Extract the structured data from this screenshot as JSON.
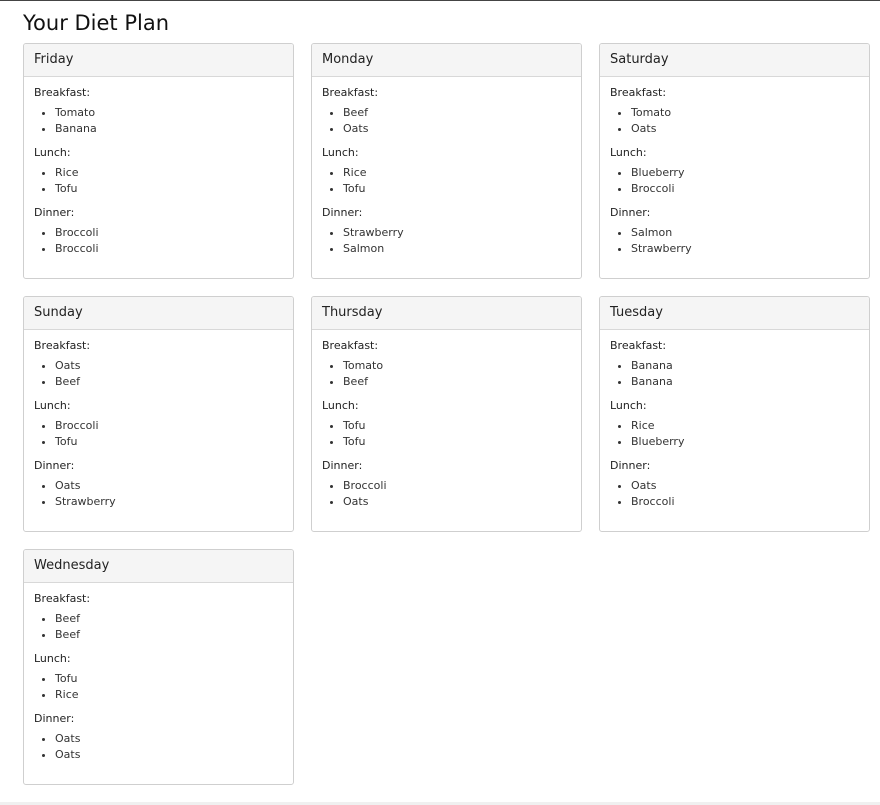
{
  "page": {
    "title": "Your Diet Plan"
  },
  "meal_labels": {
    "breakfast": "Breakfast:",
    "lunch": "Lunch:",
    "dinner": "Dinner:"
  },
  "days": [
    {
      "name": "Friday",
      "breakfast": [
        "Tomato",
        "Banana"
      ],
      "lunch": [
        "Rice",
        "Tofu"
      ],
      "dinner": [
        "Broccoli",
        "Broccoli"
      ]
    },
    {
      "name": "Monday",
      "breakfast": [
        "Beef",
        "Oats"
      ],
      "lunch": [
        "Rice",
        "Tofu"
      ],
      "dinner": [
        "Strawberry",
        "Salmon"
      ]
    },
    {
      "name": "Saturday",
      "breakfast": [
        "Tomato",
        "Oats"
      ],
      "lunch": [
        "Blueberry",
        "Broccoli"
      ],
      "dinner": [
        "Salmon",
        "Strawberry"
      ]
    },
    {
      "name": "Sunday",
      "breakfast": [
        "Oats",
        "Beef"
      ],
      "lunch": [
        "Broccoli",
        "Tofu"
      ],
      "dinner": [
        "Oats",
        "Strawberry"
      ]
    },
    {
      "name": "Thursday",
      "breakfast": [
        "Tomato",
        "Beef"
      ],
      "lunch": [
        "Tofu",
        "Tofu"
      ],
      "dinner": [
        "Broccoli",
        "Oats"
      ]
    },
    {
      "name": "Tuesday",
      "breakfast": [
        "Banana",
        "Banana"
      ],
      "lunch": [
        "Rice",
        "Blueberry"
      ],
      "dinner": [
        "Oats",
        "Broccoli"
      ]
    },
    {
      "name": "Wednesday",
      "breakfast": [
        "Beef",
        "Beef"
      ],
      "lunch": [
        "Tofu",
        "Rice"
      ],
      "dinner": [
        "Oats",
        "Oats"
      ]
    }
  ]
}
